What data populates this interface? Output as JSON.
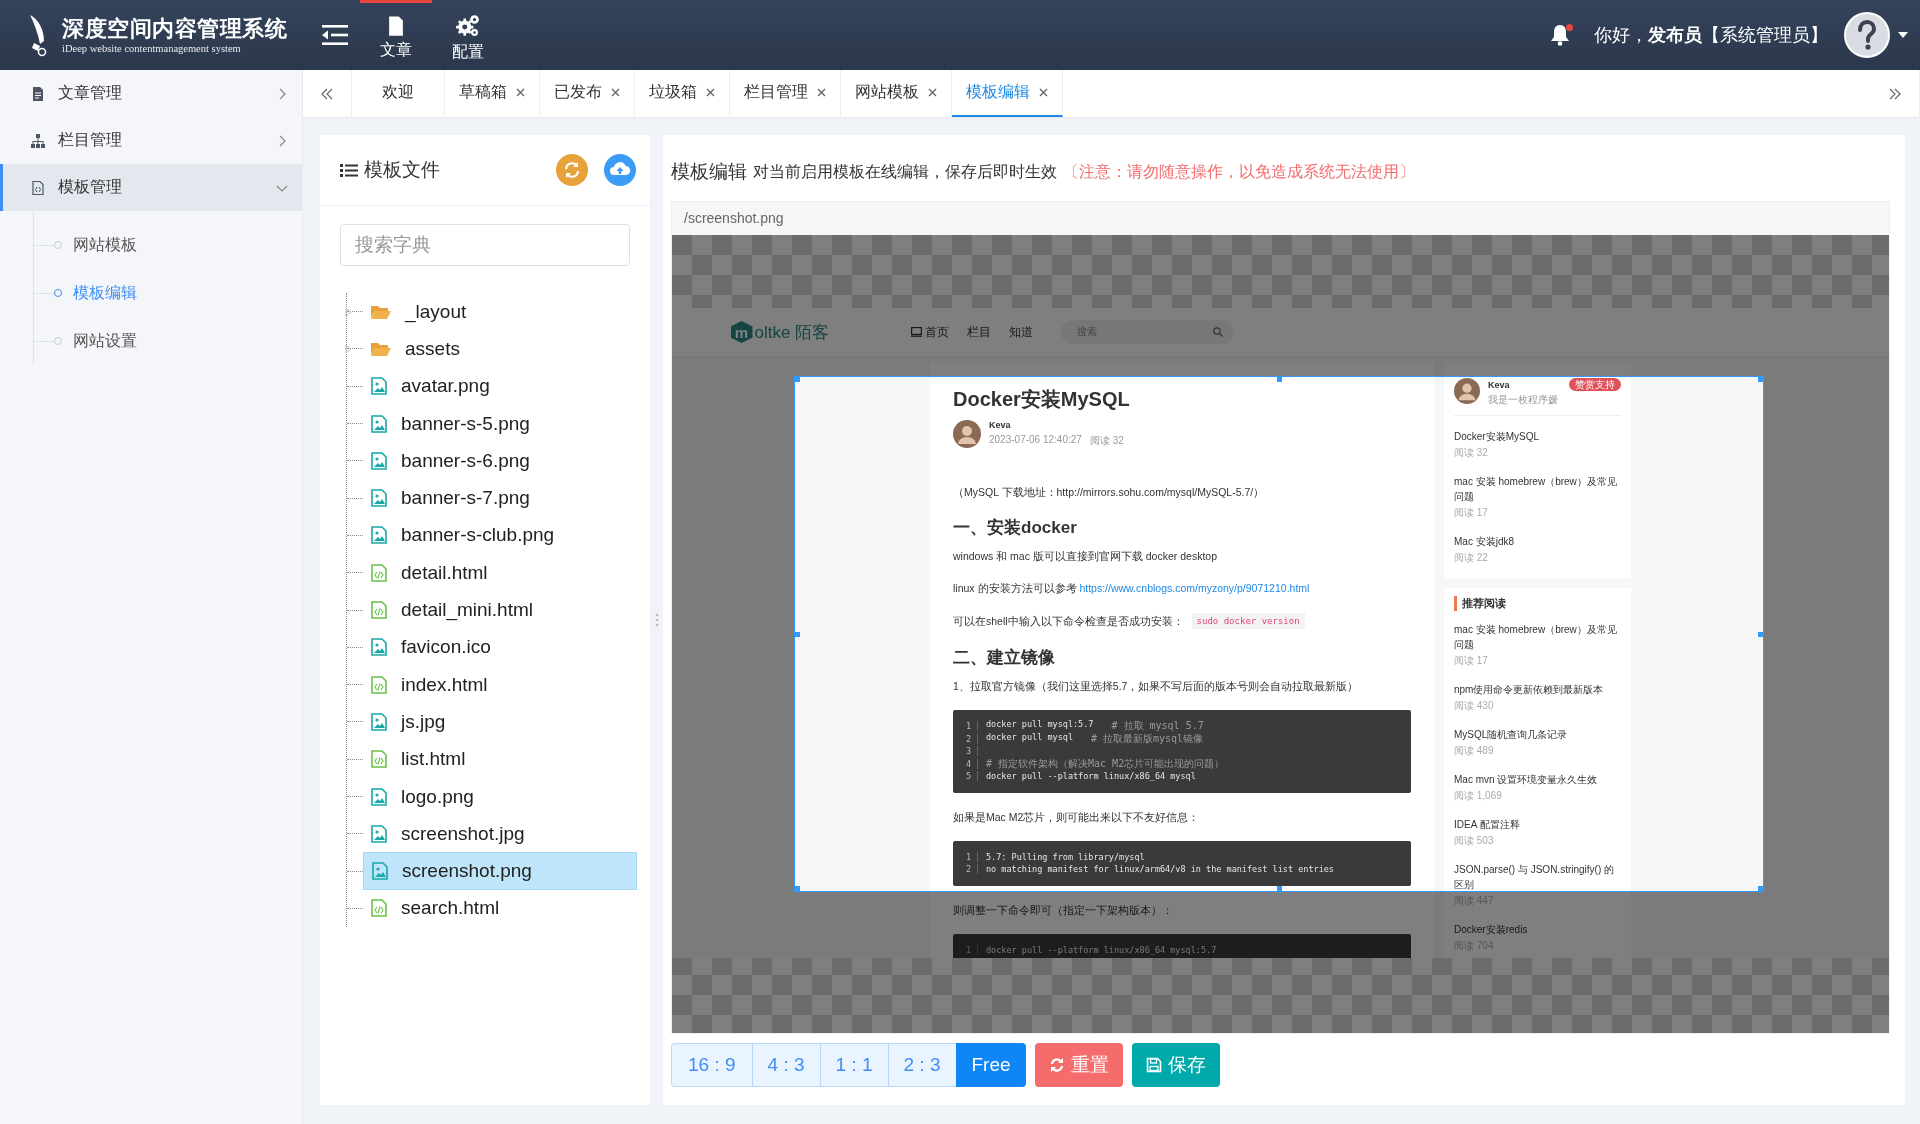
{
  "app": {
    "title": "深度空间内容管理系统",
    "subtitle": "iDeep website contentmanagement system"
  },
  "top_nav": [
    {
      "label": "文章",
      "selected": true
    },
    {
      "label": "配置",
      "selected": false
    }
  ],
  "user": {
    "greeting": "你好，**发布员**【系统管理员】",
    "unread": true
  },
  "sidebar": [
    {
      "label": "文章管理",
      "expanded": false,
      "selected": false
    },
    {
      "label": "栏目管理",
      "expanded": false,
      "selected": false
    },
    {
      "label": "模板管理",
      "expanded": true,
      "selected": true,
      "children": [
        {
          "label": "网站模板",
          "selected": false
        },
        {
          "label": "模板编辑",
          "selected": true
        },
        {
          "label": "网站设置",
          "selected": false
        }
      ]
    }
  ],
  "tabs": [
    {
      "label": "欢迎",
      "closable": false,
      "selected": false
    },
    {
      "label": "草稿箱",
      "closable": true,
      "selected": false
    },
    {
      "label": "已发布",
      "closable": true,
      "selected": false
    },
    {
      "label": "垃圾箱",
      "closable": true,
      "selected": false
    },
    {
      "label": "栏目管理",
      "closable": true,
      "selected": false
    },
    {
      "label": "网站模板",
      "closable": true,
      "selected": false
    },
    {
      "label": "模板编辑",
      "closable": true,
      "selected": true
    }
  ],
  "file_panel": {
    "title": "模板文件",
    "search_placeholder": "搜索字典",
    "tree": [
      {
        "name": "_layout",
        "kind": "folder",
        "expanded": false,
        "selected": false
      },
      {
        "name": "assets",
        "kind": "folder",
        "expanded": false,
        "selected": false
      },
      {
        "name": "avatar.png",
        "kind": "image",
        "selected": false
      },
      {
        "name": "banner-s-5.png",
        "kind": "image",
        "selected": false
      },
      {
        "name": "banner-s-6.png",
        "kind": "image",
        "selected": false
      },
      {
        "name": "banner-s-7.png",
        "kind": "image",
        "selected": false
      },
      {
        "name": "banner-s-club.png",
        "kind": "image",
        "selected": false
      },
      {
        "name": "detail.html",
        "kind": "code",
        "selected": false
      },
      {
        "name": "detail_mini.html",
        "kind": "code",
        "selected": false
      },
      {
        "name": "favicon.ico",
        "kind": "image",
        "selected": false
      },
      {
        "name": "index.html",
        "kind": "code",
        "selected": false
      },
      {
        "name": "js.jpg",
        "kind": "image",
        "selected": false
      },
      {
        "name": "list.html",
        "kind": "code",
        "selected": false
      },
      {
        "name": "logo.png",
        "kind": "image",
        "selected": false
      },
      {
        "name": "screenshot.jpg",
        "kind": "image",
        "selected": false
      },
      {
        "name": "screenshot.png",
        "kind": "image",
        "selected": true
      },
      {
        "name": "search.html",
        "kind": "code",
        "selected": false
      }
    ]
  },
  "editor": {
    "heading": "模板编辑",
    "description": "对当前启用模板在线编辑，保存后即时生效",
    "warning": "〔注意：请勿随意操作，以免造成系统无法使用〕",
    "path": "/screenshot.png",
    "preview": {
      "logo_letter": "m",
      "site_name": "oltke 陌客",
      "nav": [
        "首页",
        "栏目",
        "知道"
      ],
      "search_placeholder": "搜索",
      "article": {
        "title": "Docker安装MySQL",
        "author": "Keva",
        "date": "2023-07-06 12:40:27",
        "reads": "阅读 32",
        "blocks": [
          {
            "kind": "p",
            "text": "（MySQL 下载地址：http://mirrors.sohu.com/mysql/MySQL-5.7/）"
          },
          {
            "kind": "h2",
            "text": "一、安装docker"
          },
          {
            "kind": "p",
            "text": "windows 和 mac 版可以直接到官网下载 docker desktop"
          },
          {
            "kind": "link",
            "text": "linux 的安装方法可以参考",
            "link": "https://www.cnblogs.com/myzony/p/9071210.html"
          },
          {
            "kind": "inline_code",
            "text": "可以在shell中输入以下命令检查是否成功安装：",
            "code": "sudo docker version"
          },
          {
            "kind": "h2",
            "text": "二、建立镜像"
          },
          {
            "kind": "p",
            "text": "1、拉取官方镜像（我们这里选择5.7，如果不写后面的版本号则会自动拉取最新版）"
          },
          {
            "kind": "code",
            "lines": [
              {
                "n": "1",
                "code": "docker pull mysql:5.7",
                "comment": "# 拉取 mysql 5.7"
              },
              {
                "n": "2",
                "code": "docker pull mysql",
                "comment": "# 拉取最新版mysql镜像"
              },
              {
                "n": "3"
              },
              {
                "n": "4",
                "comment": "# 指定软件架构（解决Mac M2芯片可能出现的问题）"
              },
              {
                "n": "5",
                "code": "docker pull --platform linux/x86_64 mysql"
              }
            ]
          },
          {
            "kind": "p",
            "text": "如果是Mac M2芯片，则可能出来以下不友好信息："
          },
          {
            "kind": "code",
            "lines": [
              {
                "n": "1",
                "code": "5.7: Pulling from library/mysql"
              },
              {
                "n": "2",
                "code": "no matching manifest for linux/arm64/v8 in the manifest list entries"
              }
            ]
          },
          {
            "kind": "p",
            "text": "则调整一下命令即可（指定一下架构版本）："
          },
          {
            "kind": "code",
            "lines": [
              {
                "n": "1",
                "code": "docker pull --platform linux/x86_64 mysql:5.7"
              }
            ]
          }
        ]
      },
      "profile": {
        "name": "Keva",
        "bio": "我是一枚程序媛",
        "badge": "赞赏支持"
      },
      "recent": [
        {
          "title": "Docker安装MySQL",
          "reads": "阅读 32"
        },
        {
          "title": "mac 安装 homebrew（brew）及常见问题",
          "reads": "阅读 17"
        },
        {
          "title": "Mac 安装jdk8",
          "reads": "阅读 22"
        }
      ],
      "recommended_title": "推荐阅读",
      "recommended": [
        {
          "title": "mac 安装 homebrew（brew）及常见问题",
          "reads": "阅读 17"
        },
        {
          "title": "npm使用命令更新依赖到最新版本",
          "reads": "阅读 430"
        },
        {
          "title": "MySQL随机查询几条记录",
          "reads": "阅读 489"
        },
        {
          "title": "Mac mvn 设置环境变量永久生效",
          "reads": "阅读 1,069"
        },
        {
          "title": "IDEA 配置注释",
          "reads": "阅读 503"
        },
        {
          "title": "JSON.parse() 与 JSON.stringify() 的区别",
          "reads": "阅读 447"
        },
        {
          "title": "Docker安装redis",
          "reads": "阅读 704"
        }
      ]
    },
    "ratio_buttons": [
      {
        "label": "16 : 9",
        "selected": false
      },
      {
        "label": "4 : 3",
        "selected": false
      },
      {
        "label": "1 : 1",
        "selected": false
      },
      {
        "label": "2 : 3",
        "selected": false
      },
      {
        "label": "Free",
        "selected": true
      }
    ],
    "actions": [
      {
        "label": "重置",
        "kind": "reset"
      },
      {
        "label": "保存",
        "kind": "save"
      }
    ]
  }
}
